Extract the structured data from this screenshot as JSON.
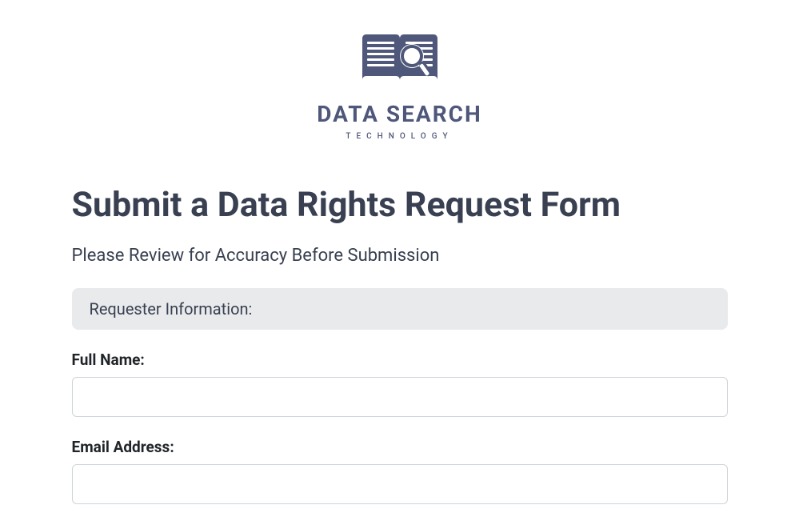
{
  "brand": {
    "name": "DATA SEARCH",
    "sub": "TECHNOLOGY"
  },
  "page": {
    "title": "Submit a Data Rights Request Form",
    "subtitle": "Please Review for Accuracy Before Submission"
  },
  "section": {
    "requester_info": "Requester Information:"
  },
  "fields": {
    "full_name": {
      "label": "Full Name:",
      "value": ""
    },
    "email": {
      "label": "Email Address:",
      "value": ""
    }
  }
}
